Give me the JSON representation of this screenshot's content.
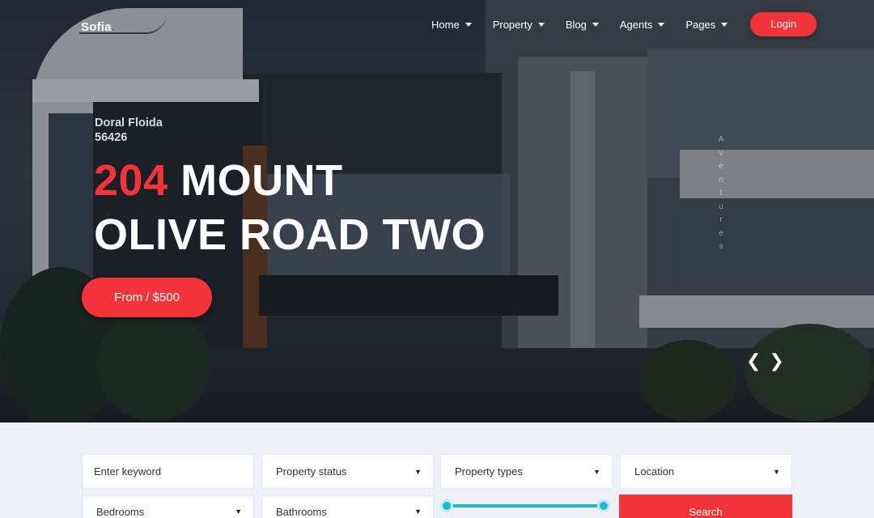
{
  "brand": {
    "name": "Sofia",
    "dot": ".",
    "accent": "#f2343a"
  },
  "nav": {
    "items": [
      {
        "label": "Home",
        "has_dropdown": true
      },
      {
        "label": "Property",
        "has_dropdown": true
      },
      {
        "label": "Blog",
        "has_dropdown": true
      },
      {
        "label": "Agents",
        "has_dropdown": true
      },
      {
        "label": "Pages",
        "has_dropdown": true
      }
    ],
    "login_label": "Login"
  },
  "hero": {
    "location_line1": "Doral Floida",
    "location_line2": "56426",
    "title_number": "204",
    "title_rest_line1": "MOUNT",
    "title_line2": "OLIVE ROAD TWO",
    "price_label": "From / $500",
    "side_text": "Aventures",
    "prev_icon": "chevron-left-icon",
    "next_icon": "chevron-right-icon"
  },
  "search": {
    "keyword_placeholder": "Enter keyword",
    "status_label": "Property status",
    "types_label": "Property types",
    "location_label": "Location",
    "bedrooms_label": "Bedrooms",
    "bathrooms_label": "Bathrooms",
    "search_label": "Search",
    "slider_color": "#22b8cc"
  }
}
